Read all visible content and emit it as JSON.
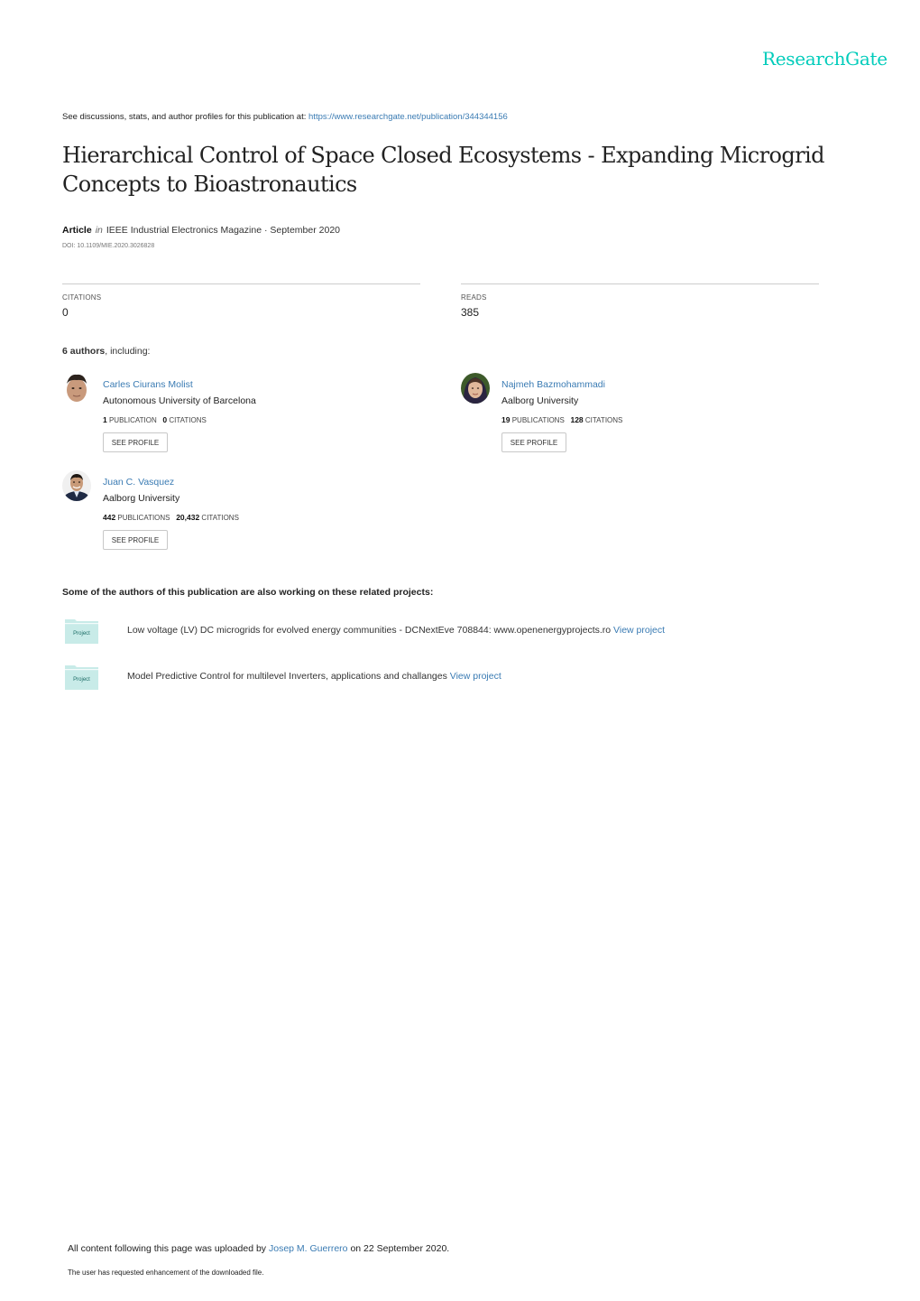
{
  "brand": "ResearchGate",
  "see_line": {
    "prefix": "See discussions, stats, and author profiles for this publication at: ",
    "url": "https://www.researchgate.net/publication/344344156"
  },
  "title": "Hierarchical Control of Space Closed Ecosystems - Expanding Microgrid Concepts to Bioastronautics",
  "meta": {
    "type": "Article",
    "in": "in",
    "venue": "IEEE Industrial Electronics Magazine · September 2020",
    "doi": "DOI: 10.1109/MIE.2020.3026828"
  },
  "stats": {
    "citations_label": "CITATIONS",
    "citations_value": "0",
    "reads_label": "READS",
    "reads_value": "385"
  },
  "authors_head": {
    "count": "6 authors",
    "suffix": ", including:"
  },
  "authors": [
    {
      "name": "Carles Ciurans Molist",
      "institution": "Autonomous University of Barcelona",
      "pubs": "1",
      "pubs_label": "PUBLICATION",
      "cites": "0",
      "cites_label": "CITATIONS",
      "button": "SEE PROFILE"
    },
    {
      "name": "Najmeh Bazmohammadi",
      "institution": "Aalborg University",
      "pubs": "19",
      "pubs_label": "PUBLICATIONS",
      "cites": "128",
      "cites_label": "CITATIONS",
      "button": "SEE PROFILE"
    },
    {
      "name": "Juan C. Vasquez",
      "institution": "Aalborg University",
      "pubs": "442",
      "pubs_label": "PUBLICATIONS",
      "cites": "20,432",
      "cites_label": "CITATIONS",
      "button": "SEE PROFILE"
    }
  ],
  "projects_head": "Some of the authors of this publication are also working on these related projects:",
  "projects": [
    {
      "icon_label": "Project",
      "text": "Low voltage (LV) DC microgrids for evolved energy communities - DCNextEve 708844: www.openenergyprojects.ro ",
      "link": "View project"
    },
    {
      "icon_label": "Project",
      "text": "Model Predictive Control for multilevel Inverters, applications and challanges ",
      "link": "View project"
    }
  ],
  "footer": {
    "prefix": "All content following this page was uploaded by ",
    "uploader": "Josep M. Guerrero",
    "suffix": " on 22 September 2020.",
    "note": "The user has requested enhancement of the downloaded file."
  },
  "colors": {
    "brand": "#00ccbb",
    "link": "#3a7bb3",
    "project_icon": "#c8ebe8"
  }
}
